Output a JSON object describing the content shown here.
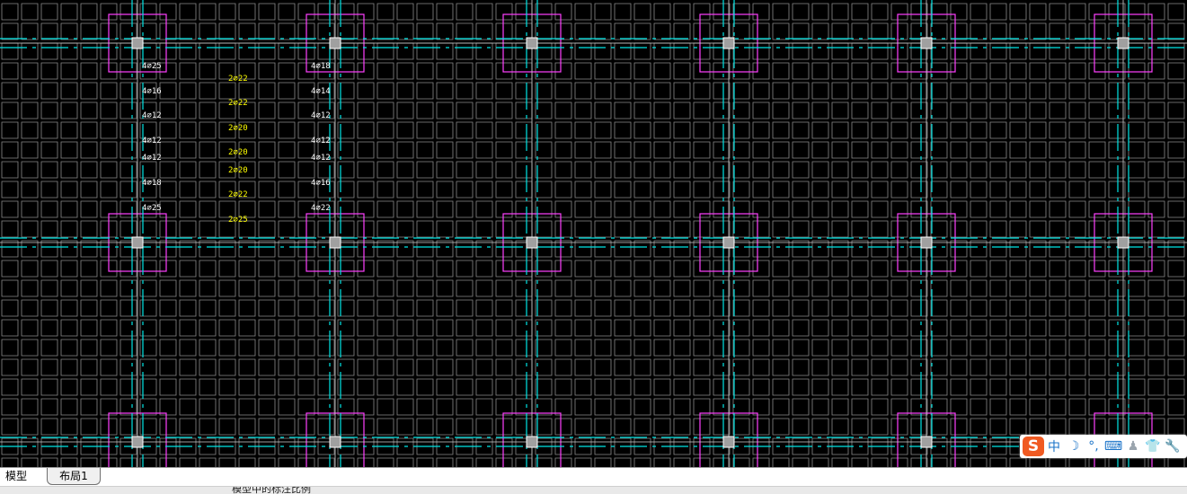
{
  "canvas": {
    "annotations": [
      {
        "text": "4⌀25",
        "color": "#ffffff"
      },
      {
        "text": "4⌀16",
        "color": "#ffffff"
      },
      {
        "text": "4⌀12",
        "color": "#ffffff"
      },
      {
        "text": "4⌀12",
        "color": "#ffffff"
      },
      {
        "text": "4⌀12",
        "color": "#ffffff"
      },
      {
        "text": "4⌀18",
        "color": "#ffffff"
      },
      {
        "text": "4⌀25",
        "color": "#ffffff"
      },
      {
        "text": "2⌀22",
        "color": "#ffff00"
      },
      {
        "text": "2⌀22",
        "color": "#ffff00"
      },
      {
        "text": "2⌀20",
        "color": "#ffff00"
      },
      {
        "text": "2⌀20",
        "color": "#ffff00"
      },
      {
        "text": "2⌀20",
        "color": "#ffff00"
      },
      {
        "text": "2⌀22",
        "color": "#ffff00"
      },
      {
        "text": "2⌀25",
        "color": "#ffff00"
      },
      {
        "text": "4⌀18",
        "color": "#ffffff"
      },
      {
        "text": "4⌀14",
        "color": "#ffffff"
      },
      {
        "text": "4⌀12",
        "color": "#ffffff"
      },
      {
        "text": "4⌀12",
        "color": "#ffffff"
      },
      {
        "text": "4⌀12",
        "color": "#ffffff"
      },
      {
        "text": "4⌀16",
        "color": "#ffffff"
      },
      {
        "text": "4⌀22",
        "color": "#ffffff"
      }
    ],
    "colors": {
      "background": "#000000",
      "grid": "#8a8a8a",
      "axis": "#00e5e5",
      "column": "#ff40ff",
      "node": "#a0a0a0"
    }
  },
  "tabs": {
    "model": "模型",
    "layout1": "布局1"
  },
  "status": {
    "text": "模型中的标注比例"
  },
  "ime": {
    "logo": "S",
    "mode": "中",
    "icons": [
      "moon-icon",
      "punctuation-icon",
      "keyboard-icon",
      "user-icon",
      "shirt-icon",
      "wrench-icon"
    ],
    "glyphs": [
      "☽",
      "°,",
      "⌨",
      "♟",
      "👕",
      "🔧"
    ]
  }
}
